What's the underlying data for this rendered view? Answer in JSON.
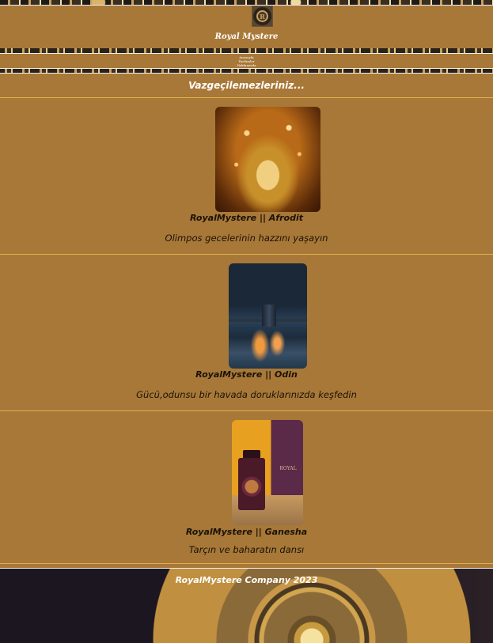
{
  "brand": {
    "title": "Royal Mystere"
  },
  "nav": {
    "items": [
      {
        "label": "Anasayfa"
      },
      {
        "label": "Parfümler"
      },
      {
        "label": "Hakkımızda"
      }
    ]
  },
  "section": {
    "title": "Vazgeçilemezleriniz..."
  },
  "products": [
    {
      "name": "RoyalMystere || Afrodit",
      "description": "Olimpos gecelerinin hazzını yaşayın",
      "image_icon": "perfume-bottle-golden-sparkle"
    },
    {
      "name": "RoyalMystere || Odin",
      "description": "Gücü,odunsu bir havada doruklarınızda keşfedin",
      "image_icon": "perfume-bottle-night-lake"
    },
    {
      "name": "RoyalMystere || Ganesha",
      "description": "Tarçın ve baharatın dansı",
      "image_icon": "perfume-bottle-purple-box"
    }
  ],
  "footer": {
    "text": "RoyalMystere Company 2023"
  },
  "colors": {
    "background": "#a87838",
    "divider": "#e0b050",
    "text_light": "#ffffff",
    "text_dark": "#1a1208"
  }
}
